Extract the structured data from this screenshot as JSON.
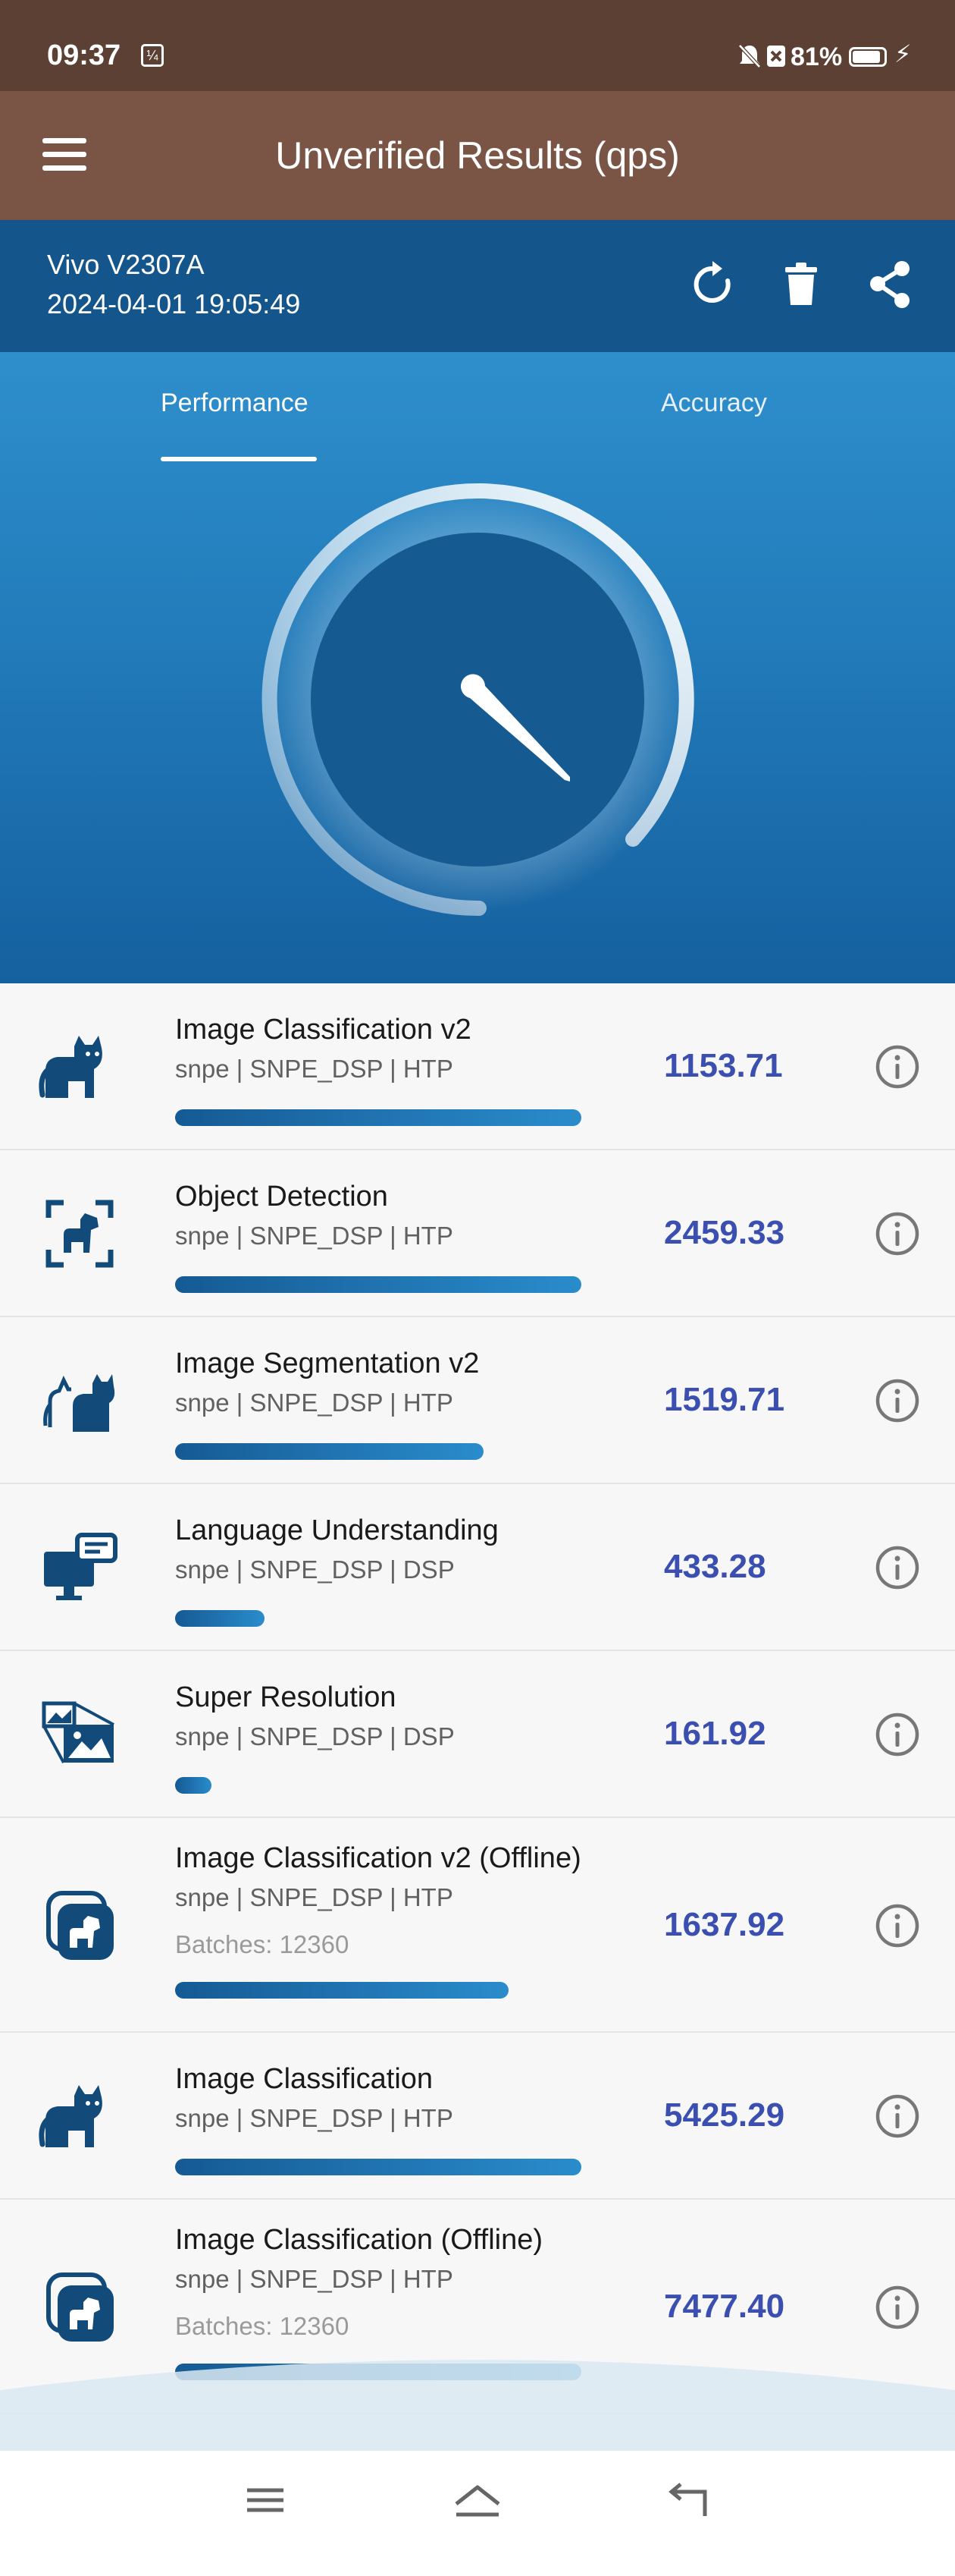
{
  "status_bar": {
    "time": "09:37",
    "battery_percent": "81%",
    "battery_level": 0.81
  },
  "app_bar": {
    "title": "Unverified Results (qps)"
  },
  "device": {
    "name": "Vivo V2307A",
    "timestamp": "2024-04-01 19:05:49"
  },
  "actions": [
    "refresh-icon",
    "delete-icon",
    "share-icon"
  ],
  "tabs": [
    {
      "label": "Performance",
      "active": true
    },
    {
      "label": "Accuracy",
      "active": false
    }
  ],
  "results": [
    {
      "name": "Image Classification v2",
      "backend": "snpe | SNPE_DSP | HTP",
      "batches": "",
      "score": "1153.71",
      "progress": 1.0,
      "icon": "cat-icon"
    },
    {
      "name": "Object Detection",
      "backend": "snpe | SNPE_DSP | HTP",
      "batches": "",
      "score": "2459.33",
      "progress": 1.0,
      "icon": "dog-detection-icon"
    },
    {
      "name": "Image Segmentation v2",
      "backend": "snpe | SNPE_DSP | HTP",
      "batches": "",
      "score": "1519.71",
      "progress": 0.76,
      "icon": "segmentation-icon"
    },
    {
      "name": "Language Understanding",
      "backend": "snpe | SNPE_DSP | DSP",
      "batches": "",
      "score": "433.28",
      "progress": 0.22,
      "icon": "computer-chat-icon"
    },
    {
      "name": "Super Resolution",
      "backend": "snpe | SNPE_DSP | DSP",
      "batches": "",
      "score": "161.92",
      "progress": 0.08,
      "icon": "image-upscale-icon"
    },
    {
      "name": "Image Classification v2 (Offline)",
      "backend": "snpe | SNPE_DSP | HTP",
      "batches": "Batches: 12360",
      "score": "1637.92",
      "progress": 0.82,
      "icon": "dog-stack-icon"
    },
    {
      "name": "Image Classification",
      "backend": "snpe | SNPE_DSP | HTP",
      "batches": "",
      "score": "5425.29",
      "progress": 1.0,
      "icon": "cat-icon"
    },
    {
      "name": "Image Classification (Offline)",
      "backend": "snpe | SNPE_DSP | HTP",
      "batches": "Batches: 12360",
      "score": "7477.40",
      "progress": 1.0,
      "icon": "dog-stack-icon"
    }
  ],
  "colors": {
    "status_bar": "#5c4033",
    "app_bar": "#7a5545",
    "device_bar": "#14568c",
    "hero_top": "#2e8fcc",
    "score": "#3b4fb0"
  }
}
